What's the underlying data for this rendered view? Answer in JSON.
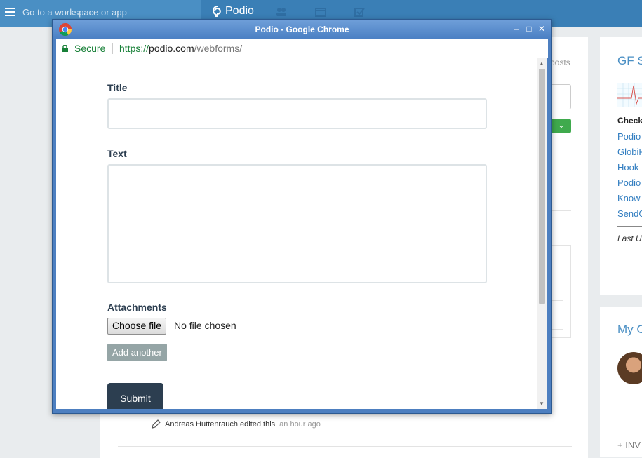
{
  "topbar": {
    "search_placeholder": "Go to a workspace or app",
    "logo_text": "Podio"
  },
  "background": {
    "posts_label": "posts",
    "activity": {
      "text": "Andreas Huttenrauch edited this",
      "time": "an hour ago"
    },
    "right_panel": {
      "title": "GF St",
      "check_label": "Check",
      "links": [
        "Podio",
        "GlobiF",
        "Hook",
        "Podio",
        "Know",
        "SendG"
      ],
      "last_label": "Last U",
      "title2": "My C",
      "invite_label": "+ INV"
    }
  },
  "window": {
    "title": "Podio - Google Chrome",
    "secure_label": "Secure",
    "url_scheme": "https://",
    "url_host": "podio.com",
    "url_path": "/webforms/"
  },
  "form": {
    "title_label": "Title",
    "text_label": "Text",
    "attachments_label": "Attachments",
    "choose_file_label": "Choose file",
    "no_file_label": "No file chosen",
    "add_another_label": "Add another",
    "submit_label": "Submit"
  },
  "colors": {
    "podio_blue": "#4a8fc4",
    "chrome_title": "#4d7fc0",
    "secure_green": "#188038",
    "submit_bg": "#2c3e50",
    "add_another_bg": "#95a5a6"
  }
}
